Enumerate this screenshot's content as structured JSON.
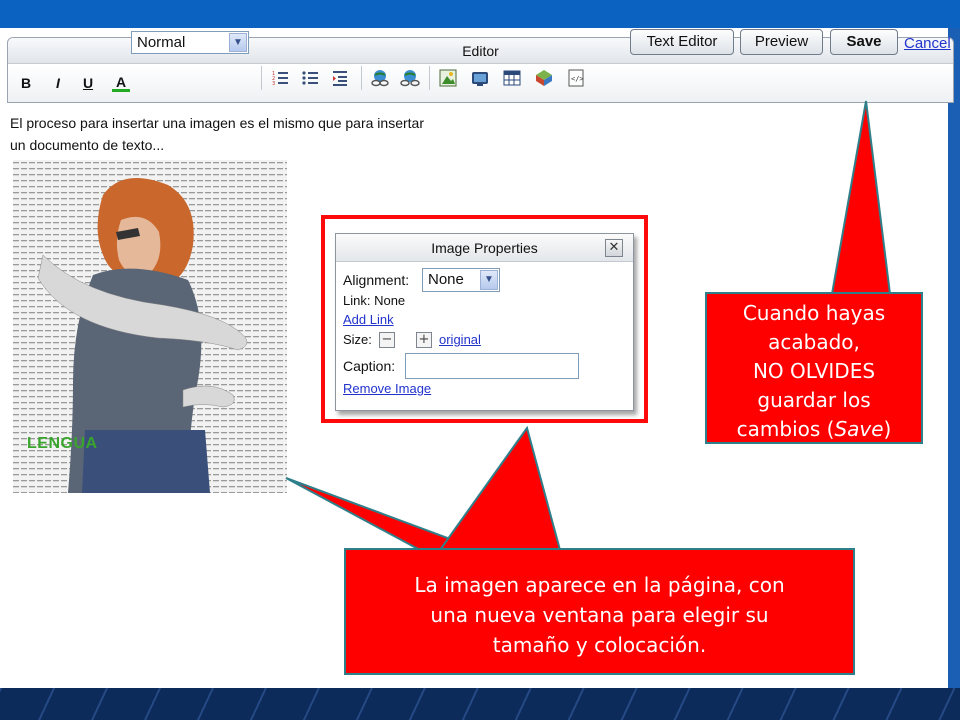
{
  "editor": {
    "title": "Editor",
    "style_value": "Normal",
    "buttons": {
      "text_editor": "Text Editor",
      "preview": "Preview",
      "save": "Save",
      "cancel": "Cancel"
    },
    "format": {
      "bold": "B",
      "italic": "I",
      "underline": "U",
      "font_color": "A"
    }
  },
  "content": {
    "line1": "El proceso para insertar una imagen es el mismo que para insertar",
    "line2": "un documento de texto...",
    "image_label": "LENGUA"
  },
  "image_properties": {
    "title": "Image Properties",
    "alignment_label": "Alignment:",
    "alignment_value": "None",
    "link_text": "Link: None",
    "add_link": "Add Link",
    "size_label": "Size:",
    "size_original": "original",
    "caption_label": "Caption:",
    "remove_image": "Remove Image"
  },
  "callouts": {
    "save_lines": [
      "Cuando hayas",
      "acabado,",
      "NO OLVIDES",
      "guardar los"
    ],
    "save_line5_prefix": "cambios (",
    "save_line5_em": "Save",
    "save_line5_suffix": ")",
    "image_lines": [
      "La imagen aparece en la página, con",
      "una nueva ventana para elegir su",
      "tamaño y colocación."
    ]
  },
  "colors": {
    "callout_fill": "#ff0000",
    "callout_border": "#2f7f8a",
    "link_blue": "#2233cc",
    "slide_blue": "#0b62c0"
  }
}
